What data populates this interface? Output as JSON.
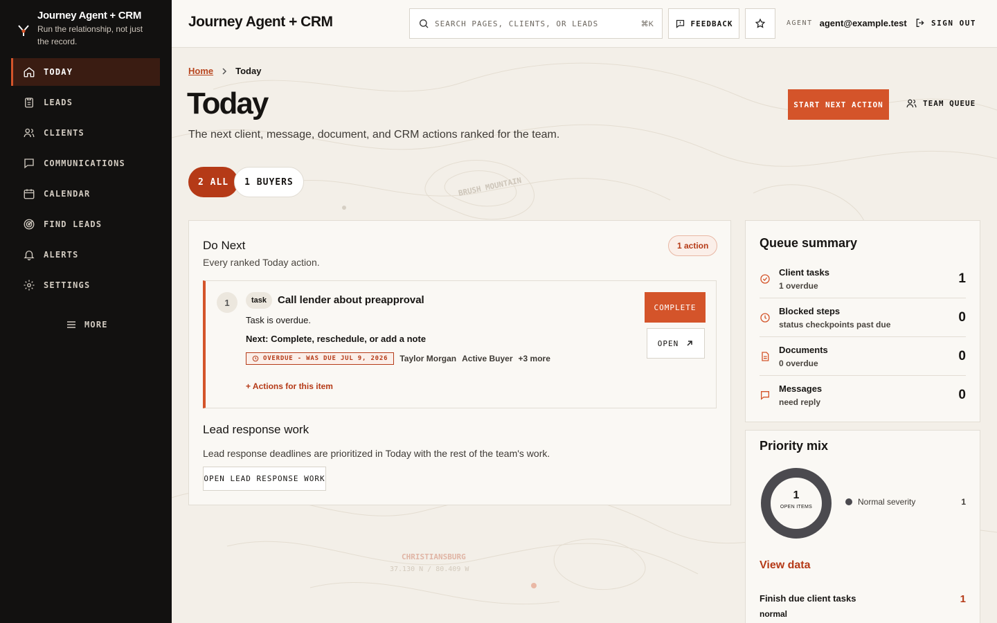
{
  "app": {
    "brand_title": "Journey Agent + CRM",
    "brand_subtitle": "Run the relationship, not just the record.",
    "header_title": "Journey Agent + CRM"
  },
  "nav": {
    "items": [
      {
        "label": "TODAY",
        "icon": "home-icon",
        "active": true
      },
      {
        "label": "LEADS",
        "icon": "clipboard-icon"
      },
      {
        "label": "CLIENTS",
        "icon": "users-icon"
      },
      {
        "label": "COMMUNICATIONS",
        "icon": "message-icon"
      },
      {
        "label": "CALENDAR",
        "icon": "calendar-icon"
      },
      {
        "label": "FIND LEADS",
        "icon": "target-icon"
      },
      {
        "label": "ALERTS",
        "icon": "bell-icon"
      },
      {
        "label": "SETTINGS",
        "icon": "gear-icon"
      }
    ],
    "more_label": "MORE"
  },
  "topbar": {
    "search_placeholder": "SEARCH PAGES, CLIENTS, OR LEADS",
    "search_shortcut": "⌘K",
    "feedback_label": "FEEDBACK",
    "agent_label": "AGENT",
    "agent_email": "agent@example.test",
    "signout_label": "SIGN OUT"
  },
  "page": {
    "breadcrumb_home": "Home",
    "breadcrumb_current": "Today",
    "title": "Today",
    "subtitle": "The next client, message, document, and CRM actions ranked for the team.",
    "start_next_action": "START NEXT ACTION",
    "team_queue": "TEAM QUEUE",
    "filters": [
      {
        "label": "2 ALL",
        "active": true
      },
      {
        "label": "1 BUYERS",
        "active": false
      }
    ]
  },
  "map_labels": {
    "brush_mountain": "BRUSH MOUNTAIN",
    "christiansburg": "CHRISTIANSBURG",
    "coords": "37.130 N / 80.409 W"
  },
  "do_next": {
    "title": "Do Next",
    "subtitle": "Every ranked Today action.",
    "badge": "1 action",
    "item": {
      "rank": "1",
      "tag": "task",
      "title": "Call lender about preapproval",
      "status": "Task is overdue.",
      "next": "Next: Complete, reschedule, or add a note",
      "overdue": "OVERDUE - WAS DUE JUL 9, 2026",
      "client": "Taylor Morgan",
      "stage": "Active Buyer",
      "more": "+3 more",
      "actions_link": "+ Actions for this item",
      "complete_label": "COMPLETE",
      "open_label": "OPEN"
    }
  },
  "lead_response": {
    "title": "Lead response work",
    "description": "Lead response deadlines are prioritized in Today with the rest of the team's work.",
    "button": "OPEN LEAD RESPONSE WORK"
  },
  "queue_summary": {
    "title": "Queue summary",
    "rows": [
      {
        "label": "Client tasks",
        "sub": "1 overdue",
        "count": "1",
        "icon": "check-circle-icon"
      },
      {
        "label": "Blocked steps",
        "sub": "status checkpoints past due",
        "count": "0",
        "icon": "clock-icon"
      },
      {
        "label": "Documents",
        "sub": "0 overdue",
        "count": "0",
        "icon": "document-icon"
      },
      {
        "label": "Messages",
        "sub": "need reply",
        "count": "0",
        "icon": "message-icon"
      }
    ]
  },
  "priority_mix": {
    "title": "Priority mix",
    "total": "1",
    "total_label": "OPEN ITEMS",
    "legend_label": "Normal severity",
    "legend_value": "1",
    "segment_color": "#4b4a4f",
    "view_data": "View data",
    "finish_label": "Finish due client tasks",
    "finish_sub": "normal",
    "finish_value": "1"
  },
  "colors": {
    "accent": "#d4542a",
    "accent_dark": "#b53a17",
    "sidebar_bg": "#121110"
  }
}
